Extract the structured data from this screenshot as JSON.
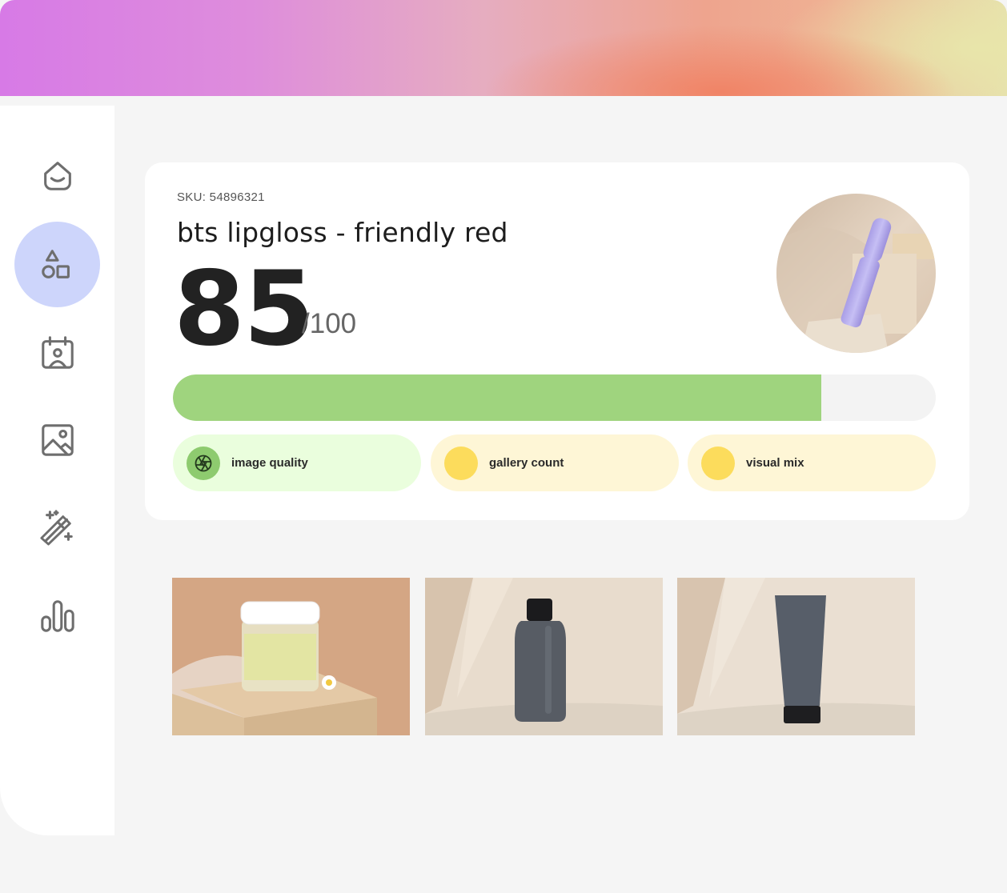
{
  "sidebar": {
    "items": [
      {
        "icon": "smile-home-icon",
        "active": false
      },
      {
        "icon": "shapes-icon",
        "active": true
      },
      {
        "icon": "calendar-user-icon",
        "active": false
      },
      {
        "icon": "image-icon",
        "active": false
      },
      {
        "icon": "magic-wand-icon",
        "active": false
      },
      {
        "icon": "bar-chart-icon",
        "active": false
      }
    ]
  },
  "product": {
    "sku_label": "SKU: 54896321",
    "title": "bts lipgloss - friendly red",
    "score": "85",
    "score_max": "/100",
    "score_fraction": 0.85
  },
  "metrics": [
    {
      "label": "image quality",
      "status": "good",
      "icon": "aperture-icon"
    },
    {
      "label": "gallery count",
      "status": "warn",
      "icon": "status-dot-icon"
    },
    {
      "label": "visual mix",
      "status": "warn",
      "icon": "status-dot-icon"
    }
  ],
  "colors": {
    "progress_fill": "#9fd47e",
    "good_bg": "#eafedd",
    "warn_bg": "#fef6d6",
    "active_nav": "#cdd5fb"
  },
  "gallery": [
    {
      "subject": "cream jar"
    },
    {
      "subject": "dark bottle"
    },
    {
      "subject": "dark tube"
    }
  ]
}
